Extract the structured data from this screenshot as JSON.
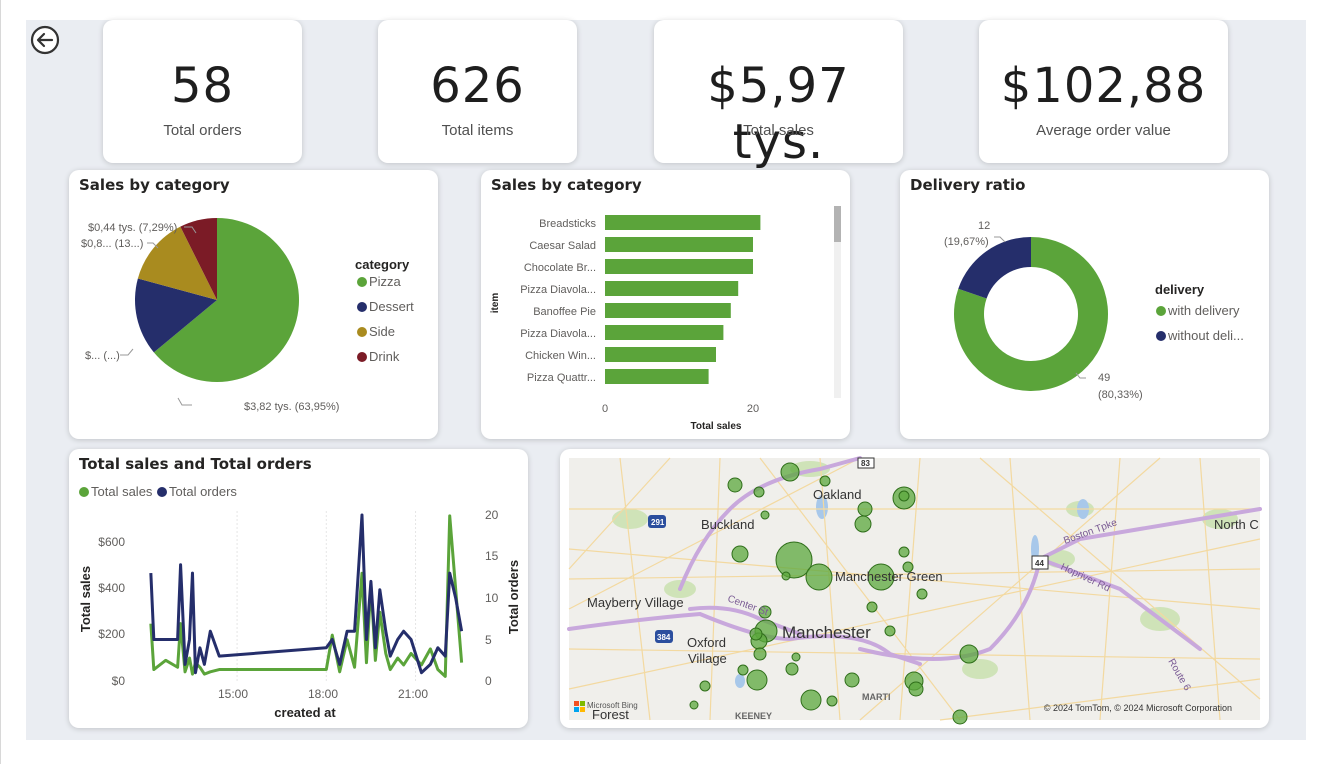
{
  "kpis": [
    {
      "value": "58",
      "label": "Total orders"
    },
    {
      "value": "626",
      "label": "Total items"
    },
    {
      "value": "$5,97 tys.",
      "label": "Total sales"
    },
    {
      "value": "$102,88",
      "label": "Average order value"
    }
  ],
  "colors": {
    "green": "#5ba43a",
    "navy": "#252e6b",
    "gold": "#a98b1f",
    "maroon": "#7b1b26",
    "canvas": "#eaedf2"
  },
  "pie": {
    "title": "Sales by category",
    "legend_title": "category",
    "legend": [
      "Pizza",
      "Dessert",
      "Side",
      "Drink"
    ],
    "labels": {
      "pizza": "$3,82 tys. (63,95%)",
      "dessert": "$... (...)",
      "side": "$0,8... (13...)",
      "drink": "$0,44 tys. (7,29%)"
    }
  },
  "bars": {
    "title": "Sales by category",
    "ylabel": "item",
    "xlabel": "Total sales",
    "xticks": [
      "0",
      "20"
    ]
  },
  "donut": {
    "title": "Delivery ratio",
    "legend_title": "delivery",
    "legend": [
      "with delivery",
      "without deli..."
    ],
    "label_small_value": "12",
    "label_small_pct": "(19,67%)",
    "label_big_value": "49",
    "label_big_pct": "(80,33%)"
  },
  "combo": {
    "title": "Total sales and Total orders",
    "legend": [
      "Total sales",
      "Total orders"
    ],
    "ylabel_left": "Total sales",
    "ylabel_right": "Total orders",
    "xlabel": "created at",
    "yticks_left": [
      "$0",
      "$200",
      "$400",
      "$600"
    ],
    "yticks_right": [
      "0",
      "5",
      "10",
      "15",
      "20"
    ],
    "xticks": [
      "15:00",
      "18:00",
      "21:00"
    ]
  },
  "map": {
    "places": [
      "Oakland",
      "Buckland",
      "North C",
      "Manchester Green",
      "Mayberry Village",
      "Manchester",
      "Oxford",
      "Village",
      "Forest",
      "KEENEY",
      "MARTI",
      "Boston Tpke",
      "Hopriver Rd",
      "Center St",
      "Route 6"
    ],
    "shields": [
      "83",
      "291",
      "44",
      "384"
    ],
    "attribution": "© 2024 TomTom, © 2024 Microsoft Corporation",
    "provider": "Microsoft Bing"
  },
  "chart_data": [
    {
      "type": "pie",
      "title": "Sales by category",
      "legend_title": "category",
      "categories": [
        "Pizza",
        "Dessert",
        "Side",
        "Drink"
      ],
      "values": [
        3.82,
        0.91,
        0.8,
        0.44
      ],
      "percent": [
        63.95,
        15.3,
        13.46,
        7.29
      ],
      "legend_placement": "right"
    },
    {
      "type": "bar",
      "orientation": "horizontal",
      "title": "Sales by category",
      "categories": [
        "Breadsticks",
        "Caesar Salad",
        "Chocolate Br...",
        "Pizza Diavola...",
        "Banoffee Pie",
        "Pizza Diavola...",
        "Chicken Win...",
        "Pizza Quattr..."
      ],
      "values": [
        21,
        20,
        20,
        18,
        17,
        16,
        15,
        14
      ],
      "xlabel": "Total sales",
      "ylabel": "item",
      "xlim": [
        0,
        25
      ]
    },
    {
      "type": "pie",
      "donut": true,
      "title": "Delivery ratio",
      "legend_title": "delivery",
      "categories": [
        "with delivery",
        "without deli..."
      ],
      "values": [
        49,
        12
      ],
      "percent": [
        80.33,
        19.67
      ],
      "legend_placement": "right"
    },
    {
      "type": "line",
      "title": "Total sales and Total orders",
      "xlabel": "created at",
      "ylabel": "Total sales",
      "ylabel_right": "Total orders",
      "ylim": [
        0,
        750
      ],
      "ylim_right": [
        0,
        20
      ],
      "x": [
        12.1,
        12.2,
        12.6,
        13.0,
        13.1,
        13.25,
        13.4,
        13.5,
        13.6,
        13.75,
        13.9,
        14.1,
        14.4,
        18.0,
        18.2,
        18.45,
        18.7,
        18.95,
        19.2,
        19.35,
        19.5,
        19.65,
        19.8,
        20.0,
        20.15,
        20.4,
        20.6,
        20.85,
        21.2,
        21.5,
        21.75,
        22.0,
        22.15,
        22.35,
        22.55
      ],
      "series": [
        {
          "name": "Total sales",
          "axis": "left",
          "values": [
            250,
            50,
            90,
            60,
            250,
            40,
            100,
            30,
            80,
            60,
            30,
            40,
            50,
            50,
            200,
            40,
            180,
            60,
            470,
            80,
            420,
            90,
            300,
            120,
            50,
            100,
            70,
            120,
            70,
            140,
            50,
            20,
            720,
            400,
            80
          ]
        },
        {
          "name": "Total orders",
          "axis": "right",
          "values": [
            13,
            5,
            5,
            5,
            14,
            2,
            5,
            13,
            1,
            4,
            2,
            6,
            3,
            4,
            5,
            2,
            6,
            6,
            20,
            5,
            12,
            4,
            11,
            6,
            3,
            5,
            6,
            5,
            1,
            2,
            4,
            3,
            13,
            10,
            6
          ]
        }
      ],
      "legend_placement": "top-left"
    }
  ]
}
